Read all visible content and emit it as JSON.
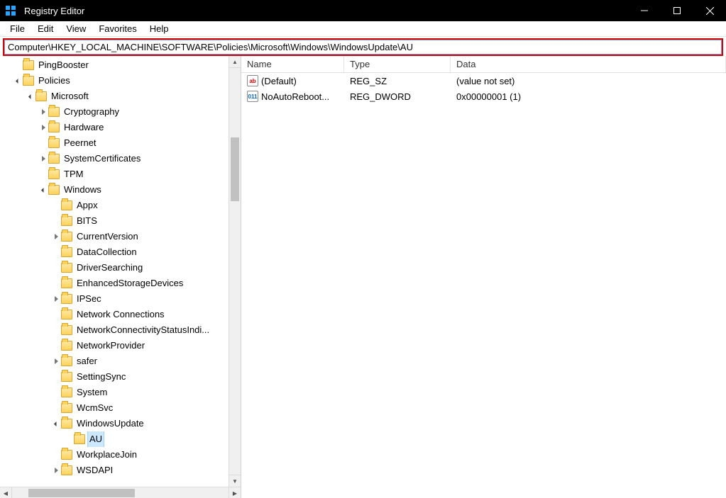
{
  "titlebar": {
    "title": "Registry Editor"
  },
  "menubar": [
    "File",
    "Edit",
    "View",
    "Favorites",
    "Help"
  ],
  "addressbar": {
    "value": "Computer\\HKEY_LOCAL_MACHINE\\SOFTWARE\\Policies\\Microsoft\\Windows\\WindowsUpdate\\AU"
  },
  "tree": [
    {
      "indent": 1,
      "chev": "none",
      "label": "PingBooster"
    },
    {
      "indent": 1,
      "chev": "down",
      "label": "Policies"
    },
    {
      "indent": 2,
      "chev": "down",
      "label": "Microsoft"
    },
    {
      "indent": 3,
      "chev": "right",
      "label": "Cryptography"
    },
    {
      "indent": 3,
      "chev": "right",
      "label": "Hardware"
    },
    {
      "indent": 3,
      "chev": "none",
      "label": "Peernet"
    },
    {
      "indent": 3,
      "chev": "right",
      "label": "SystemCertificates"
    },
    {
      "indent": 3,
      "chev": "none",
      "label": "TPM"
    },
    {
      "indent": 3,
      "chev": "down",
      "label": "Windows"
    },
    {
      "indent": 4,
      "chev": "none",
      "label": "Appx"
    },
    {
      "indent": 4,
      "chev": "none",
      "label": "BITS"
    },
    {
      "indent": 4,
      "chev": "right",
      "label": "CurrentVersion"
    },
    {
      "indent": 4,
      "chev": "none",
      "label": "DataCollection"
    },
    {
      "indent": 4,
      "chev": "none",
      "label": "DriverSearching"
    },
    {
      "indent": 4,
      "chev": "none",
      "label": "EnhancedStorageDevices"
    },
    {
      "indent": 4,
      "chev": "right",
      "label": "IPSec"
    },
    {
      "indent": 4,
      "chev": "none",
      "label": "Network Connections"
    },
    {
      "indent": 4,
      "chev": "none",
      "label": "NetworkConnectivityStatusIndi..."
    },
    {
      "indent": 4,
      "chev": "none",
      "label": "NetworkProvider"
    },
    {
      "indent": 4,
      "chev": "right",
      "label": "safer"
    },
    {
      "indent": 4,
      "chev": "none",
      "label": "SettingSync"
    },
    {
      "indent": 4,
      "chev": "none",
      "label": "System"
    },
    {
      "indent": 4,
      "chev": "none",
      "label": "WcmSvc"
    },
    {
      "indent": 4,
      "chev": "down",
      "label": "WindowsUpdate"
    },
    {
      "indent": 5,
      "chev": "none",
      "label": "AU",
      "selected": true
    },
    {
      "indent": 4,
      "chev": "none",
      "label": "WorkplaceJoin"
    },
    {
      "indent": 4,
      "chev": "right",
      "label": "WSDAPI"
    }
  ],
  "list": {
    "columns": [
      "Name",
      "Type",
      "Data"
    ],
    "rows": [
      {
        "icon": "str",
        "name": "(Default)",
        "type": "REG_SZ",
        "data": "(value not set)"
      },
      {
        "icon": "bin",
        "name": "NoAutoReboot...",
        "type": "REG_DWORD",
        "data": "0x00000001 (1)"
      }
    ]
  }
}
